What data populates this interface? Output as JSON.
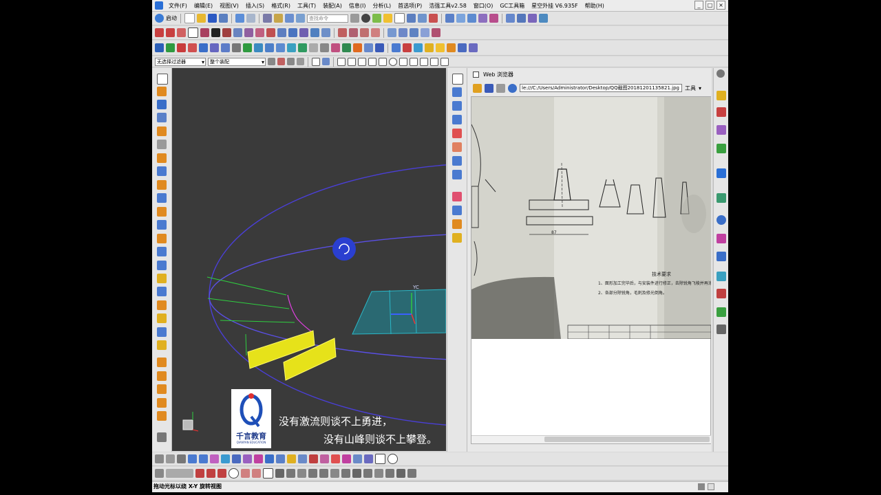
{
  "menubar": {
    "items": [
      "文件(F)",
      "编辑(E)",
      "视图(V)",
      "插入(S)",
      "格式(R)",
      "工具(T)",
      "装配(A)",
      "信息(I)",
      "分析(L)",
      "首选项(P)",
      "浩强工具v2.58",
      "窗口(O)",
      "GC工具箱",
      "星空外挂 V6.935F",
      "帮助(H)"
    ]
  },
  "window_controls": {
    "minimize": "_",
    "maximize": "□",
    "close": "×"
  },
  "toolbar1": {
    "start_label": "启动",
    "search_placeholder": "查找命令"
  },
  "selection_bar": {
    "filter": "无选择过滤器",
    "scope": "整个装配"
  },
  "web_browser": {
    "title": "Web 浏览器",
    "url": "le:///C:/Users/Administrator/Desktop/QQ截图20181201135821.jpg",
    "tools_label": "工具"
  },
  "drawing": {
    "tech_title": "技术要求",
    "req1": "1、面形加工完毕后，与安装件进行修正，去除锐角飞棱并再涂过油",
    "req2": "2、各部分除锐角，毛刺及修光倒角。"
  },
  "viewport": {
    "axis_label": "YC",
    "slogan_line1": "没有激流则谈不上勇进，",
    "slogan_line2": "没有山峰则谈不上攀登。"
  },
  "logo": {
    "name": "千言教育",
    "subtitle": "QIANYAN EDUCATION"
  },
  "status_bar": {
    "text": "拖动光标以绕 X-Y 旋转视图"
  },
  "colors": {
    "viewport_bg": "#3a3a3a",
    "ring": "#4a3fd6",
    "yellow_panel": "#e6e21a",
    "plane": "#1e8fa0"
  }
}
